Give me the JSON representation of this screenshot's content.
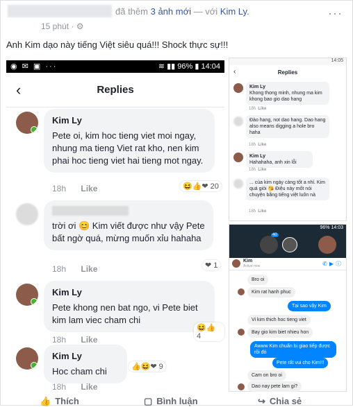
{
  "header": {
    "action_text": "đã thêm",
    "photos_link": "3 ảnh mới",
    "separator": "—",
    "with_text": "với",
    "tagged_name": "Kim Ly.",
    "time": "15 phút",
    "time_sep": "·",
    "privacy_icon": "globe-icon",
    "more_icon": "more-icon"
  },
  "post_text": "Anh Kim dạo này tiếng Việt siêu quá!!! Shock thực sự!!!",
  "main_phone": {
    "status_battery": "96%",
    "status_time": "14:04",
    "title": "Replies",
    "comments": [
      {
        "name": "Kim Ly",
        "body": "Pete oi, kim hoc tieng viet moi ngay, nhung ma tieng Viet rat kho, nen kim phai hoc tieng viet hai tieng mot ngay.",
        "time": "18h",
        "like": "Like",
        "reactions": "20"
      },
      {
        "name": "",
        "body": "trời ơi 😊 Kim viết được như vậy Pete bất ngờ quá, mừng muốn xỉu hahaha",
        "time": "18h",
        "like": "Like",
        "reactions": "1"
      },
      {
        "name": "Kim Ly",
        "body": "Pete khong nen bat ngo, vi Pete biet kim lam viec cham chi",
        "time": "18h",
        "like": "Like",
        "reactions": "4"
      },
      {
        "name": "Kim Ly",
        "body": "Hoc cham chi",
        "time": "18h",
        "like": "Like",
        "reactions": "9"
      }
    ]
  },
  "top_right_phone": {
    "status_time": "14:05",
    "title": "Replies",
    "rows": [
      {
        "name": "Kim Ly",
        "body": "Khong thong minh, nhung ma kim khong bao gio dao hang",
        "time": "18h",
        "like": "Like"
      },
      {
        "name": "",
        "body": "Đào hang, not dao hang. Dao hang also means digging a hole bro haha",
        "time": "18h",
        "like": "Like"
      },
      {
        "name": "Kim Ly",
        "body": "Hahahaha, anh xin lỗi",
        "time": "18h",
        "like": "Like"
      },
      {
        "name": "",
        "body": "... của kim ngày càng tốt a nhỉ. Kim quá giỏi 😘 Điệu này mốt nói chuyện bằng tiếng việt luôn nà",
        "time": "18h",
        "like": "Like"
      }
    ]
  },
  "bottom_right_phone": {
    "status_battery": "96%",
    "status_time": "14:03",
    "contact_name": "Kim",
    "contact_status": "Active now",
    "badge": "40",
    "messages": [
      {
        "dir": "in",
        "text": "Bro oi"
      },
      {
        "dir": "in",
        "text": "Kim rat hanh phuc"
      },
      {
        "dir": "out",
        "text": "Tại sao vậy Kim"
      },
      {
        "dir": "in",
        "text": "Vi kim thich hoc tieng viet"
      },
      {
        "dir": "in",
        "text": "Bay gio kim biet nhieu hon"
      },
      {
        "dir": "out",
        "text": "Awww Kim chuẩn bị giao tiếp được rồi đó"
      },
      {
        "dir": "out",
        "text": "Pete rất vui cho Kim!!!"
      },
      {
        "dir": "in",
        "text": "Cam on bro oi"
      },
      {
        "dir": "in",
        "text": "Dao nay pete lam gi?"
      }
    ]
  },
  "footer": {
    "like_label": "Thích",
    "comment_label": "Bình luận",
    "share_label": "Chia sẻ"
  }
}
